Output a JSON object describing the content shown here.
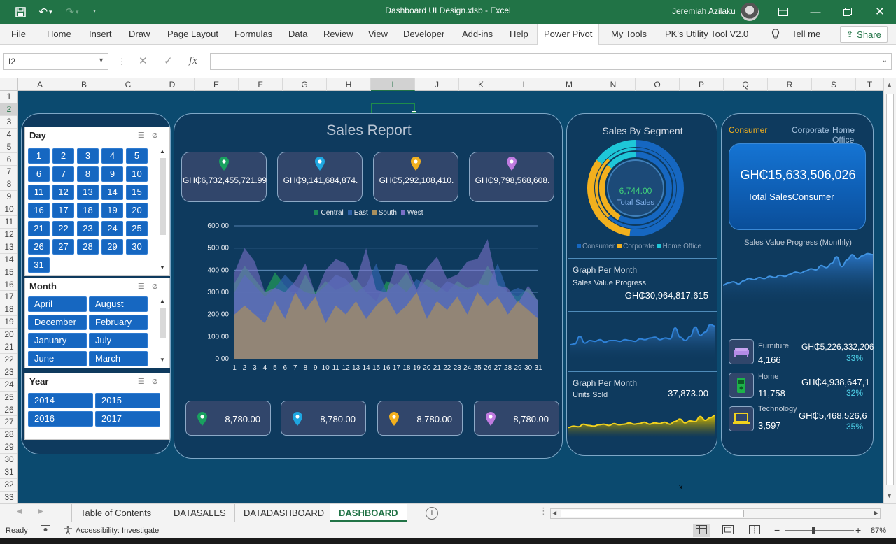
{
  "window": {
    "title": "Dashboard UI Design.xlsb  -  Excel",
    "user": "Jeremiah Azilaku"
  },
  "ribbon": {
    "tabs": [
      "File",
      "Home",
      "Insert",
      "Draw",
      "Page Layout",
      "Formulas",
      "Data",
      "Review",
      "View",
      "Developer",
      "Add-ins",
      "Help",
      "Power Pivot",
      "My Tools",
      "PK's Utility Tool V2.0"
    ],
    "active_tab": "Power Pivot",
    "tell_me": "Tell me",
    "share": "Share"
  },
  "formula_bar": {
    "name_box": "I2",
    "fx": "fx",
    "value": ""
  },
  "columns": [
    "A",
    "B",
    "C",
    "D",
    "E",
    "F",
    "G",
    "H",
    "I",
    "J",
    "K",
    "L",
    "M",
    "N",
    "O",
    "P",
    "Q",
    "R",
    "S",
    "T"
  ],
  "selected_column": "I",
  "rows": [
    "1",
    "2",
    "3",
    "4",
    "5",
    "6",
    "7",
    "8",
    "9",
    "10",
    "11",
    "12",
    "13",
    "14",
    "15",
    "16",
    "17",
    "18",
    "19",
    "20",
    "21",
    "22",
    "23",
    "24",
    "25",
    "26",
    "27",
    "28",
    "29",
    "30",
    "31",
    "32",
    "33"
  ],
  "selected_row": "2",
  "slicers": {
    "day": {
      "title": "Day",
      "items": [
        "1",
        "2",
        "3",
        "4",
        "5",
        "6",
        "7",
        "8",
        "9",
        "10",
        "11",
        "12",
        "13",
        "14",
        "15",
        "16",
        "17",
        "18",
        "19",
        "20",
        "21",
        "22",
        "23",
        "24",
        "25",
        "26",
        "27",
        "28",
        "29",
        "30",
        "31"
      ]
    },
    "month": {
      "title": "Month",
      "items": [
        "April",
        "August",
        "December",
        "February",
        "January",
        "July",
        "June",
        "March"
      ]
    },
    "year": {
      "title": "Year",
      "items": [
        "2014",
        "2015",
        "2016",
        "2017"
      ]
    }
  },
  "sales_report": {
    "title": "Sales Report",
    "kpis": [
      {
        "value": "GH₵6,732,455,721.99",
        "color": "#19a15f"
      },
      {
        "value": "GH₵9,141,684,874.",
        "color": "#1ea7e1"
      },
      {
        "value": "GH₵5,292,108,410.",
        "color": "#f2b01e"
      },
      {
        "value": "GH₵9,798,568,608.",
        "color": "#c07be0"
      }
    ],
    "bottom_cards": [
      {
        "value": "8,780.00",
        "color": "#19a15f"
      },
      {
        "value": "8,780.00",
        "color": "#1ea7e1"
      },
      {
        "value": "8,780.00",
        "color": "#f2b01e"
      },
      {
        "value": "8,780.00",
        "color": "#c07be0"
      }
    ]
  },
  "chart_data": {
    "type": "area",
    "x": [
      1,
      2,
      3,
      4,
      5,
      6,
      7,
      8,
      9,
      10,
      11,
      12,
      13,
      14,
      15,
      16,
      17,
      18,
      19,
      20,
      21,
      22,
      23,
      24,
      25,
      26,
      27,
      28,
      29,
      30,
      31
    ],
    "ylim": [
      0,
      600
    ],
    "yticks": [
      "0.00",
      "100.00",
      "200.00",
      "300.00",
      "400.00",
      "500.00",
      "600.00"
    ],
    "grid": true,
    "legend_position": "top",
    "series": [
      {
        "name": "Central",
        "color": "#1e8c5a",
        "values": [
          340,
          420,
          360,
          300,
          390,
          330,
          280,
          380,
          300,
          350,
          310,
          330,
          360,
          300,
          260,
          350,
          330,
          390,
          300,
          360,
          330,
          300,
          350,
          320,
          330,
          420,
          340,
          300,
          280,
          320,
          260
        ]
      },
      {
        "name": "East",
        "color": "#2f62a8",
        "values": [
          300,
          380,
          330,
          280,
          320,
          380,
          330,
          300,
          290,
          330,
          380,
          360,
          300,
          330,
          430,
          300,
          340,
          300,
          360,
          330,
          300,
          350,
          330,
          310,
          340,
          330,
          430,
          300,
          320,
          300,
          260
        ]
      },
      {
        "name": "South",
        "color": "#a88f5e",
        "values": [
          200,
          240,
          200,
          160,
          260,
          180,
          300,
          220,
          280,
          160,
          240,
          200,
          260,
          180,
          240,
          280,
          200,
          240,
          300,
          180,
          260,
          220,
          280,
          200,
          300,
          240,
          280,
          200,
          260,
          220,
          180
        ]
      },
      {
        "name": "West",
        "color": "#7a6fc7",
        "values": [
          390,
          500,
          440,
          300,
          320,
          300,
          350,
          430,
          290,
          400,
          450,
          430,
          350,
          500,
          310,
          300,
          430,
          420,
          310,
          410,
          460,
          360,
          380,
          440,
          450,
          540,
          330,
          320,
          250,
          330,
          260
        ]
      }
    ]
  },
  "segment": {
    "title": "Sales By Segment",
    "center_value": "6,744.00",
    "center_label": "Total Sales",
    "legend": [
      {
        "name": "Consumer",
        "color": "#1667c1"
      },
      {
        "name": "Corporate",
        "color": "#f2b01e"
      },
      {
        "name": "Home Office",
        "color": "#1ec7d8"
      }
    ],
    "rings": [
      {
        "Consumer": 0.52,
        "Corporate": 0.33,
        "Home Office": 0.15
      },
      {
        "Consumer": 0.62,
        "Corporate": 0.26,
        "Home Office": 0.12
      },
      {
        "Consumer": 0.58,
        "Corporate": 0.28,
        "Home Office": 0.14
      }
    ],
    "graph1": {
      "title": "Graph Per Month",
      "subtitle": "Sales Value Progress",
      "value": "GH₵30,964,817,615",
      "values": [
        40,
        42,
        60,
        44,
        50,
        48,
        52,
        46,
        50,
        50,
        48,
        52,
        50,
        48,
        54,
        52,
        56,
        58,
        52,
        56,
        54,
        80,
        58,
        50,
        60,
        82,
        62,
        70,
        88,
        84
      ]
    },
    "graph2": {
      "title": "Graph Per Month",
      "subtitle": "Units Sold",
      "value": "37,873.00",
      "values": [
        30,
        34,
        32,
        40,
        36,
        34,
        38,
        40,
        36,
        42,
        38,
        40,
        44,
        40,
        42,
        46,
        40,
        44,
        42,
        46,
        40,
        48,
        56,
        44,
        50,
        48,
        64,
        52,
        60,
        68
      ]
    }
  },
  "category": {
    "tabs": [
      "Consumer",
      "Corporate",
      "Home Office"
    ],
    "active_tab": "Consumer",
    "total_value": "GH₵15,633,506,026",
    "total_label": "Total SalesConsumer",
    "progress_label": "Sales Value Progress (Monthly)",
    "progress_values": [
      40,
      44,
      46,
      42,
      48,
      52,
      50,
      54,
      52,
      56,
      54,
      58,
      56,
      60,
      64,
      62,
      66,
      70,
      68,
      76,
      72,
      80,
      92,
      74,
      86,
      96,
      88,
      94,
      98,
      96
    ],
    "items": [
      {
        "name": "Furniture",
        "count": "4,166",
        "value": "GH₵5,226,332,206",
        "pct": "33%"
      },
      {
        "name": "Home",
        "count": "11,758",
        "value": "GH₵4,938,647,1",
        "pct": "32%"
      },
      {
        "name": "Technology",
        "count": "3,597",
        "value": "GH₵5,468,526,6",
        "pct": "35%"
      }
    ]
  },
  "stray_text": "x",
  "sheet_tabs": [
    "Table of Contents",
    "DATASALES",
    "DATADASHBOARD",
    "DASHBOARD"
  ],
  "active_sheet": "DASHBOARD",
  "status": {
    "ready": "Ready",
    "accessibility": "Accessibility: Investigate",
    "zoom": "87%"
  }
}
